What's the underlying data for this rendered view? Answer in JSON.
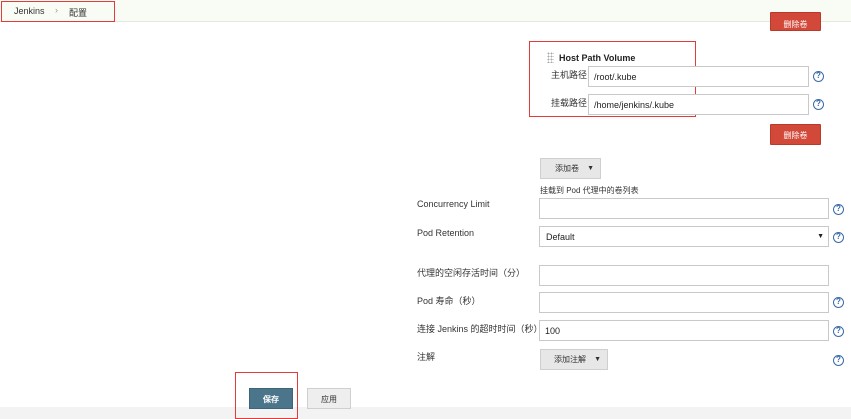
{
  "breadcrumb": {
    "home": "Jenkins",
    "separator": "›",
    "current": "配置"
  },
  "volumes": {
    "top_delete_label": "删除卷",
    "host_path_volume": {
      "title": "Host Path Volume",
      "host_path_label": "主机路径",
      "host_path_value": "/root/.kube",
      "mount_path_label": "挂载路径",
      "mount_path_value": "/home/jenkins/.kube",
      "delete_label": "删除卷"
    },
    "add_label": "添加卷",
    "description": "挂载到 Pod 代理中的卷列表"
  },
  "fields": {
    "concurrency_limit": {
      "label": "Concurrency Limit",
      "value": ""
    },
    "pod_retention": {
      "label": "Pod Retention",
      "value": "Default"
    },
    "idle_minutes": {
      "label": "代理的空闲存活时间（分）",
      "value": ""
    },
    "pod_lifetime": {
      "label": "Pod 寿命（秒）",
      "value": ""
    },
    "connect_timeout": {
      "label": "连接 Jenkins 的超时时间（秒）",
      "value": "100"
    },
    "annotations": {
      "label": "注解",
      "add_label": "添加注解"
    }
  },
  "actions": {
    "save_label": "保存",
    "apply_label": "应用"
  },
  "icons": {
    "help": "?",
    "caret": "▼",
    "select_arrow": "▼"
  },
  "colors": {
    "danger": "#d24939",
    "primary": "#4b758b",
    "help": "#3a6aa8"
  }
}
